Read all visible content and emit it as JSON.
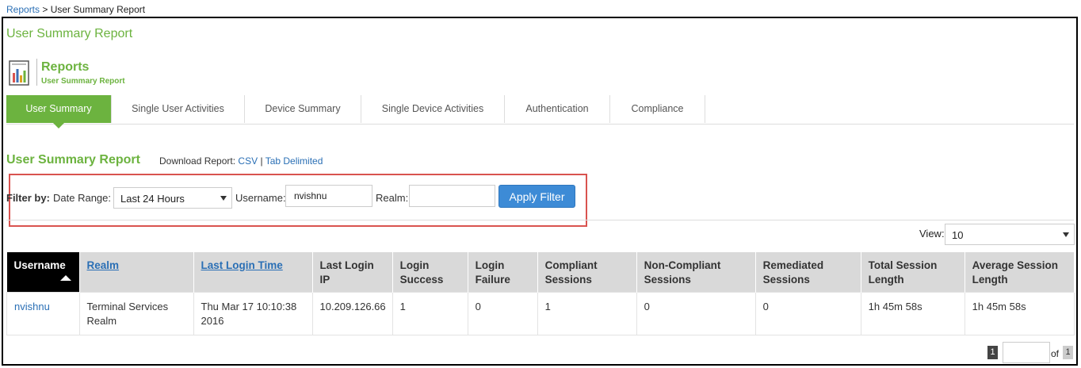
{
  "breadcrumb": {
    "root": "Reports",
    "sep": " > ",
    "current": "User Summary Report"
  },
  "page_title": "User Summary Report",
  "header": {
    "title": "Reports",
    "subtitle": "User Summary Report"
  },
  "tabs": [
    {
      "label": "User Summary",
      "active": true
    },
    {
      "label": "Single User Activities",
      "active": false
    },
    {
      "label": "Device Summary",
      "active": false
    },
    {
      "label": "Single Device Activities",
      "active": false
    },
    {
      "label": "Authentication",
      "active": false
    },
    {
      "label": "Compliance",
      "active": false
    }
  ],
  "section_title": "User Summary Report",
  "download": {
    "label": "Download Report:",
    "csv": "CSV",
    "sep": "|",
    "tab": "Tab Delimited"
  },
  "filter": {
    "by_label": "Filter by:",
    "date_range_label": "Date Range:",
    "date_range_value": "Last 24 Hours",
    "username_label": "Username:",
    "username_value": "nvishnu",
    "realm_label": "Realm:",
    "realm_value": "",
    "apply_label": "Apply Filter"
  },
  "view": {
    "label": "View:",
    "value": "10"
  },
  "table": {
    "columns": [
      {
        "l1": "Username",
        "l2": ""
      },
      {
        "l1": "Realm",
        "l2": ""
      },
      {
        "l1": "Last Login Time",
        "l2": ""
      },
      {
        "l1": "Last Login",
        "l2": "IP"
      },
      {
        "l1": "Login",
        "l2": "Success"
      },
      {
        "l1": "Login",
        "l2": "Failure"
      },
      {
        "l1": "Compliant",
        "l2": "Sessions"
      },
      {
        "l1": "Non-Compliant",
        "l2": "Sessions"
      },
      {
        "l1": "Remediated",
        "l2": "Sessions"
      },
      {
        "l1": "Total Session",
        "l2": "Length"
      },
      {
        "l1": "Average Session",
        "l2": "Length"
      }
    ],
    "rows": [
      {
        "username": "nvishnu",
        "realm_l1": "Terminal Services",
        "realm_l2": "Realm",
        "time_l1": "Thu Mar 17 10:10:38",
        "time_l2": "2016",
        "ip": "10.209.126.66",
        "success": "1",
        "failure": "0",
        "compliant": "1",
        "noncompliant": "0",
        "remediated": "0",
        "total": "1h 45m 58s",
        "average": "1h 45m 58s"
      }
    ]
  },
  "pager": {
    "current": "1",
    "of": "of",
    "total": "1"
  },
  "colors": {
    "accent": "#6cb33f",
    "link": "#2a6fb5",
    "button": "#3d8bd6",
    "highlight": "#d9534f"
  }
}
